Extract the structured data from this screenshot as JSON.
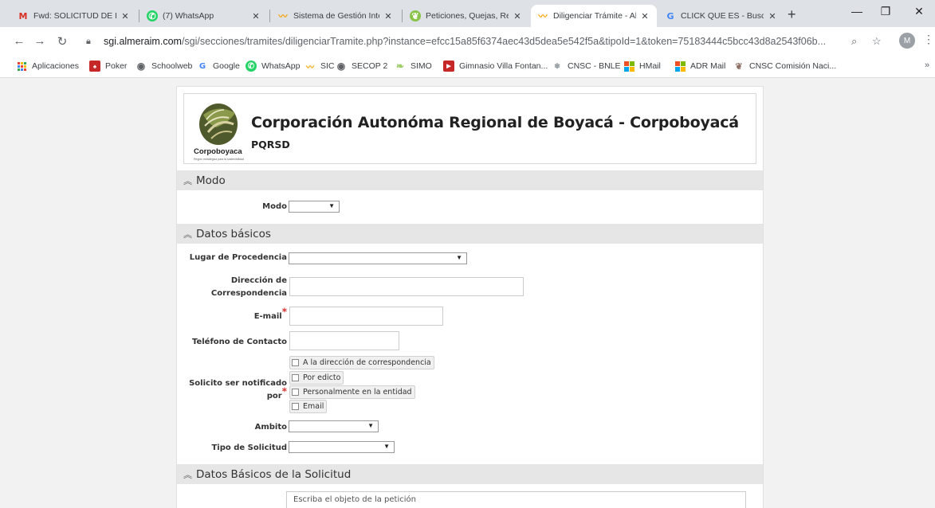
{
  "browser": {
    "tabs": [
      {
        "title": "Fwd: SOLICITUD DE INF",
        "icon": "gmail-icon"
      },
      {
        "title": "(7) WhatsApp",
        "icon": "whatsapp-icon"
      },
      {
        "title": "Sistema de Gestión Inte",
        "icon": "almeraim-icon"
      },
      {
        "title": "Peticiones, Quejas, Recl",
        "icon": "corpoboyaca-icon"
      },
      {
        "title": "Diligenciar Trámite - Al",
        "icon": "almeraim-icon",
        "active": true
      },
      {
        "title": "CLICK QUE ES - Buscar",
        "icon": "google-icon"
      }
    ],
    "new_tab": "+",
    "url_host": "sgi.almeraim.com",
    "url_path": "/sgi/secciones/tramites/diligenciarTramite.php?instance=efcc15a85f6374aec43d5dea5e542f5a&tipoId=1&token=75183444c5bcc43d8a2543f06b...",
    "profile_initial": "M",
    "bookmarks": [
      {
        "label": "Aplicaciones",
        "icon": "apps-icon"
      },
      {
        "label": "Poker",
        "icon": "poker-icon"
      },
      {
        "label": "Schoolweb",
        "icon": "globe-icon"
      },
      {
        "label": "Google",
        "icon": "google-icon"
      },
      {
        "label": "WhatsApp",
        "icon": "whatsapp-icon"
      },
      {
        "label": "SIC",
        "icon": "almeraim-icon"
      },
      {
        "label": "SECOP 2",
        "icon": "globe-icon"
      },
      {
        "label": "SIMO",
        "icon": "leaf-icon"
      },
      {
        "label": "Gimnasio Villa Fontan...",
        "icon": "gym-icon"
      },
      {
        "label": "CNSC - BNLE",
        "icon": "cnsc-icon"
      },
      {
        "label": "HMail",
        "icon": "microsoft-icon"
      },
      {
        "label": "ADR Mail",
        "icon": "microsoft-icon"
      },
      {
        "label": "CNSC Comisión Naci...",
        "icon": "cnsc-icon"
      }
    ],
    "more": "»"
  },
  "header": {
    "org_title": "Corporación Autonóma Regional de Boyacá - Corpoboyacá",
    "subtitle": "PQRSD",
    "logo_text": "Corpoboyaca",
    "logo_tagline": "Región estratégica para la sostenibilidad"
  },
  "sections": {
    "modo": "Modo",
    "datos_basicos": "Datos básicos",
    "datos_solicitud": "Datos Básicos de la Solicitud"
  },
  "form": {
    "modo_label": "Modo",
    "lugar_label": "Lugar de Procedencia",
    "direccion_label_1": "Dirección de",
    "direccion_label_2": "Correspondencia",
    "email_label": "E-mail",
    "telefono_label": "Teléfono de Contacto",
    "notificado_label": "Solicito ser notificado por",
    "required_mark": "*",
    "notify_options": [
      "A la dirección de correspondencia",
      "Por edicto",
      "Personalmente en la entidad",
      "Email"
    ],
    "ambito_label": "Ambito",
    "tipo_label": "Tipo de Solicitud",
    "objeto_placeholder": "Escriba el objeto de la petición",
    "select_arrow": "▼"
  },
  "colors": {
    "section_bg": "#e6e6e6",
    "required": "#d32f2f",
    "chrome_bg": "#dee1e6"
  }
}
